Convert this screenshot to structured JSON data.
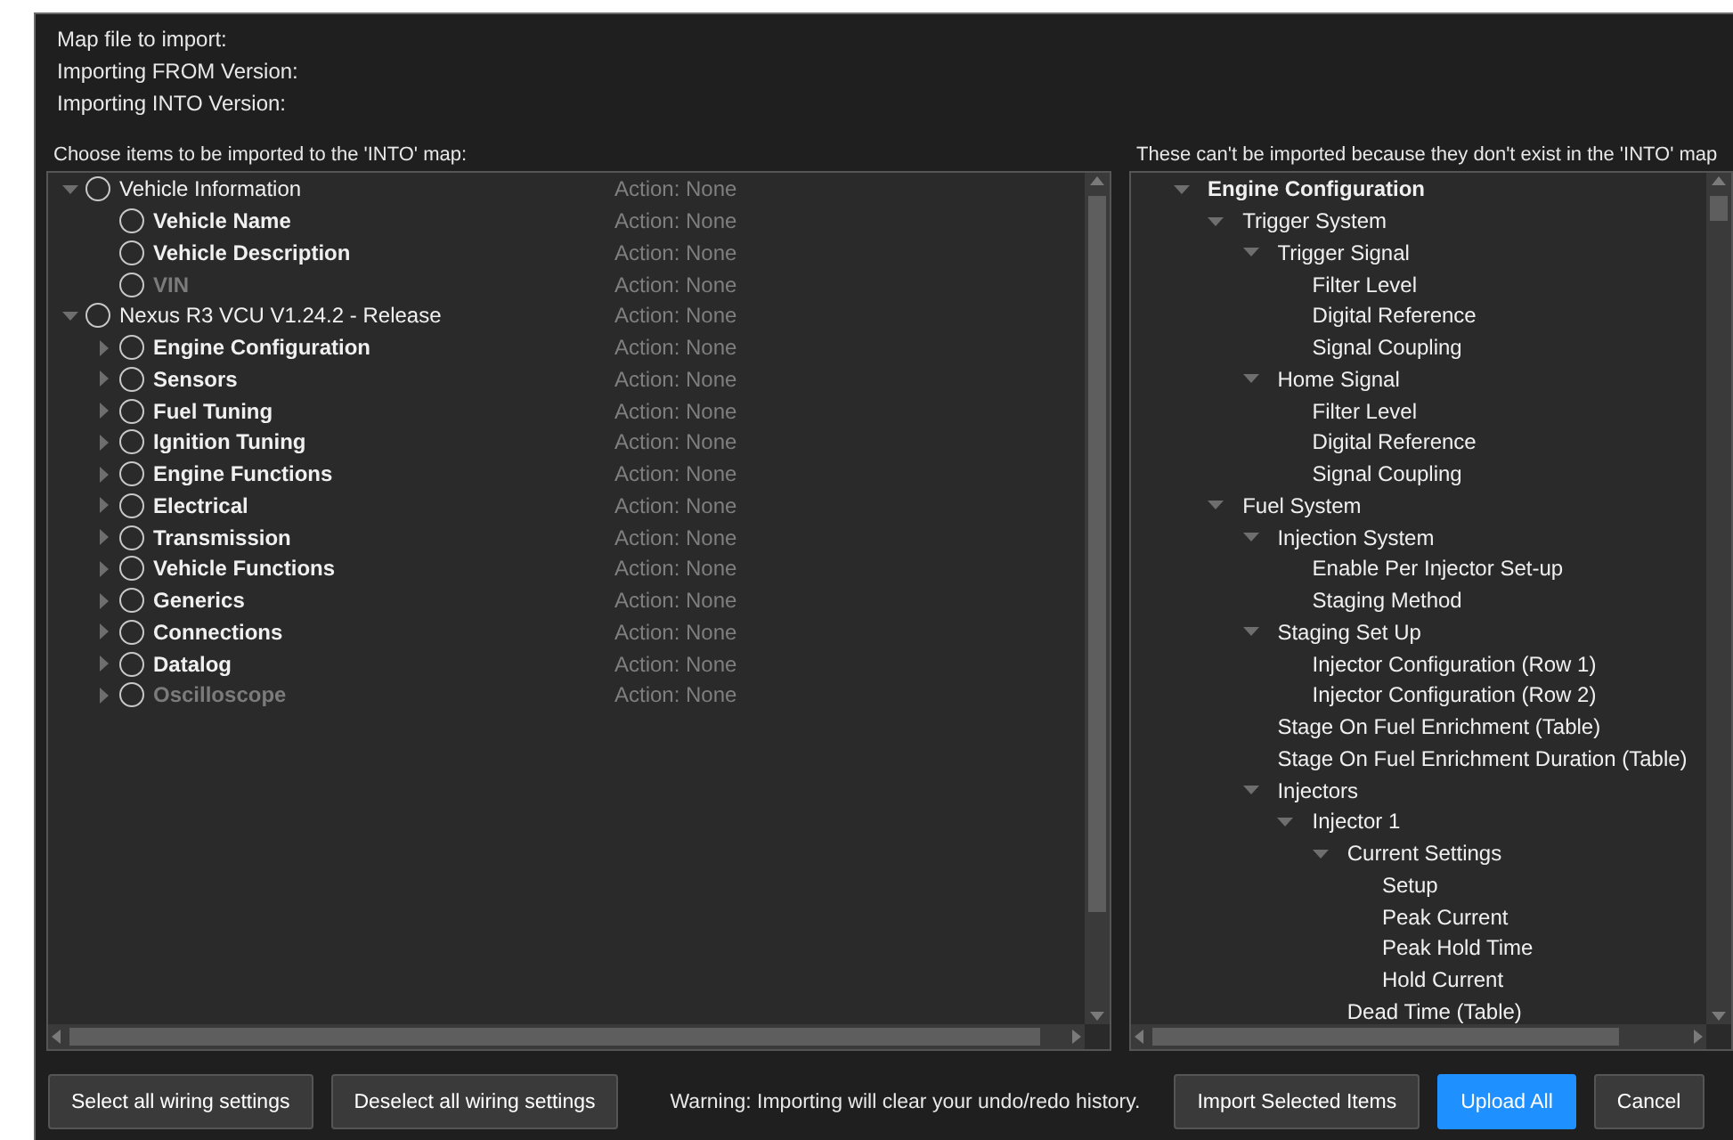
{
  "header": {
    "lines": [
      "Map file to import:",
      "Importing FROM Version:",
      "Importing INTO Version:"
    ]
  },
  "import_panel": {
    "label": "Choose items to be imported to the 'INTO' map:",
    "items": [
      {
        "label": "Vehicle Information",
        "bold": false,
        "disabled": false,
        "expanded": true,
        "checked": false,
        "action": "Action: None",
        "children": [
          {
            "label": "Vehicle Name",
            "bold": true,
            "disabled": false,
            "checked": false,
            "action": "Action: None"
          },
          {
            "label": "Vehicle Description",
            "bold": true,
            "disabled": false,
            "checked": false,
            "action": "Action: None"
          },
          {
            "label": "VIN",
            "bold": true,
            "disabled": true,
            "checked": false,
            "action": "Action: None"
          }
        ]
      },
      {
        "label": "Nexus R3 VCU V1.24.2 - Release",
        "bold": false,
        "disabled": false,
        "expanded": true,
        "checked": false,
        "action": "Action: None",
        "children": [
          {
            "label": "Engine Configuration",
            "bold": true,
            "disabled": false,
            "expanded": false,
            "checked": false,
            "action": "Action: None"
          },
          {
            "label": "Sensors",
            "bold": true,
            "disabled": false,
            "expanded": false,
            "checked": false,
            "action": "Action: None"
          },
          {
            "label": "Fuel Tuning",
            "bold": true,
            "disabled": false,
            "expanded": false,
            "checked": false,
            "action": "Action: None"
          },
          {
            "label": "Ignition Tuning",
            "bold": true,
            "disabled": false,
            "expanded": false,
            "checked": false,
            "action": "Action: None"
          },
          {
            "label": "Engine Functions",
            "bold": true,
            "disabled": false,
            "expanded": false,
            "checked": false,
            "action": "Action: None"
          },
          {
            "label": "Electrical",
            "bold": true,
            "disabled": false,
            "expanded": false,
            "checked": false,
            "action": "Action: None"
          },
          {
            "label": "Transmission",
            "bold": true,
            "disabled": false,
            "expanded": false,
            "checked": false,
            "action": "Action: None"
          },
          {
            "label": "Vehicle Functions",
            "bold": true,
            "disabled": false,
            "expanded": false,
            "checked": false,
            "action": "Action: None"
          },
          {
            "label": "Generics",
            "bold": true,
            "disabled": false,
            "expanded": false,
            "checked": false,
            "action": "Action: None"
          },
          {
            "label": "Connections",
            "bold": true,
            "disabled": false,
            "expanded": false,
            "checked": false,
            "action": "Action: None"
          },
          {
            "label": "Datalog",
            "bold": true,
            "disabled": false,
            "expanded": false,
            "checked": false,
            "action": "Action: None"
          },
          {
            "label": "Oscilloscope",
            "bold": true,
            "disabled": true,
            "expanded": false,
            "checked": false,
            "action": "Action: None"
          }
        ]
      }
    ]
  },
  "missing_panel": {
    "label": "These can't be imported because they don't exist in the 'INTO' map",
    "items": [
      {
        "label": "Engine Configuration",
        "bold": true,
        "expanded": true,
        "children": [
          {
            "label": "Trigger System",
            "expanded": true,
            "children": [
              {
                "label": "Trigger Signal",
                "expanded": true,
                "children": [
                  {
                    "label": "Filter Level"
                  },
                  {
                    "label": "Digital Reference"
                  },
                  {
                    "label": "Signal Coupling"
                  }
                ]
              },
              {
                "label": "Home Signal",
                "expanded": true,
                "children": [
                  {
                    "label": "Filter Level"
                  },
                  {
                    "label": "Digital Reference"
                  },
                  {
                    "label": "Signal Coupling"
                  }
                ]
              }
            ]
          },
          {
            "label": "Fuel System",
            "expanded": true,
            "children": [
              {
                "label": "Injection System",
                "expanded": true,
                "children": [
                  {
                    "label": "Enable Per Injector Set-up"
                  },
                  {
                    "label": "Staging Method"
                  }
                ]
              },
              {
                "label": "Staging Set Up",
                "expanded": true,
                "children": [
                  {
                    "label": "Injector Configuration (Row 1)"
                  },
                  {
                    "label": "Injector Configuration (Row 2)"
                  }
                ]
              },
              {
                "label": "Stage On Fuel Enrichment (Table)"
              },
              {
                "label": "Stage On Fuel Enrichment Duration (Table)"
              },
              {
                "label": "Injectors",
                "expanded": true,
                "children": [
                  {
                    "label": "Injector 1",
                    "expanded": true,
                    "children": [
                      {
                        "label": "Current Settings",
                        "expanded": true,
                        "children": [
                          {
                            "label": "Setup"
                          },
                          {
                            "label": "Peak Current"
                          },
                          {
                            "label": "Peak Hold Time"
                          },
                          {
                            "label": "Hold Current"
                          }
                        ]
                      },
                      {
                        "label": "Dead Time (Table)"
                      }
                    ]
                  }
                ]
              }
            ]
          }
        ]
      }
    ]
  },
  "footer": {
    "left_buttons": [
      {
        "label": "Select all wiring settings"
      },
      {
        "label": "Deselect all wiring settings"
      }
    ],
    "warning": "Warning: Importing will clear your undo/redo history.",
    "right_buttons": [
      {
        "label": "Import Selected Items",
        "kind": "plain"
      },
      {
        "label": "Upload All",
        "kind": "primary"
      },
      {
        "label": "Cancel",
        "kind": "plain"
      }
    ]
  }
}
